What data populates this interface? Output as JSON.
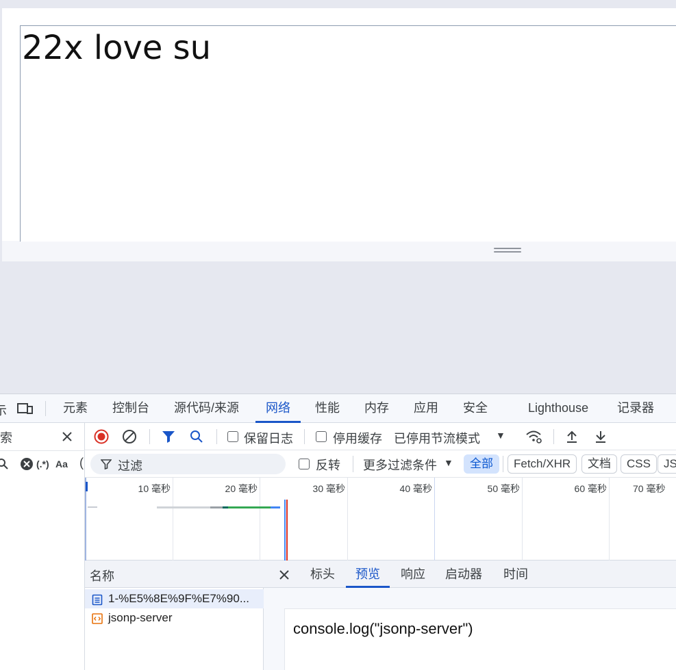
{
  "page": {
    "textarea_value": "22x love su"
  },
  "devtools": {
    "left_clip_label": "元",
    "tabs": [
      "元素",
      "控制台",
      "源代码/来源",
      "网络",
      "性能",
      "内存",
      "应用",
      "安全",
      "Lighthouse",
      "记录器"
    ],
    "active_tab": "网络",
    "search_panel": {
      "label_clip": "搜索",
      "regex_label": "(.*)",
      "case_label": "Aa"
    },
    "toolbar": {
      "preserve_log": "保留日志",
      "disable_cache": "停用缓存",
      "throttle": "已停用节流模式"
    },
    "filter": {
      "placeholder": "过滤",
      "invert": "反转",
      "more_filters": "更多过滤条件",
      "chips": [
        "全部",
        "Fetch/XHR",
        "文档",
        "CSS",
        "JS"
      ],
      "active_chip": "全部"
    },
    "timeline": {
      "ticks": [
        "10 毫秒",
        "20 毫秒",
        "30 毫秒",
        "40 毫秒",
        "50 毫秒",
        "60 毫秒",
        "70 毫秒"
      ]
    },
    "requests": {
      "header": "名称",
      "rows": [
        {
          "name": "1-%E5%8E%9F%E7%90...",
          "type": "document"
        },
        {
          "name": "jsonp-server",
          "type": "script"
        }
      ]
    },
    "detail": {
      "tabs": [
        "标头",
        "预览",
        "响应",
        "启动器",
        "时间"
      ],
      "active_tab": "预览",
      "preview_content": "console.log(\"jsonp-server\")"
    },
    "colors": {
      "accent": "#1a56c8",
      "record": "#d93025"
    }
  }
}
